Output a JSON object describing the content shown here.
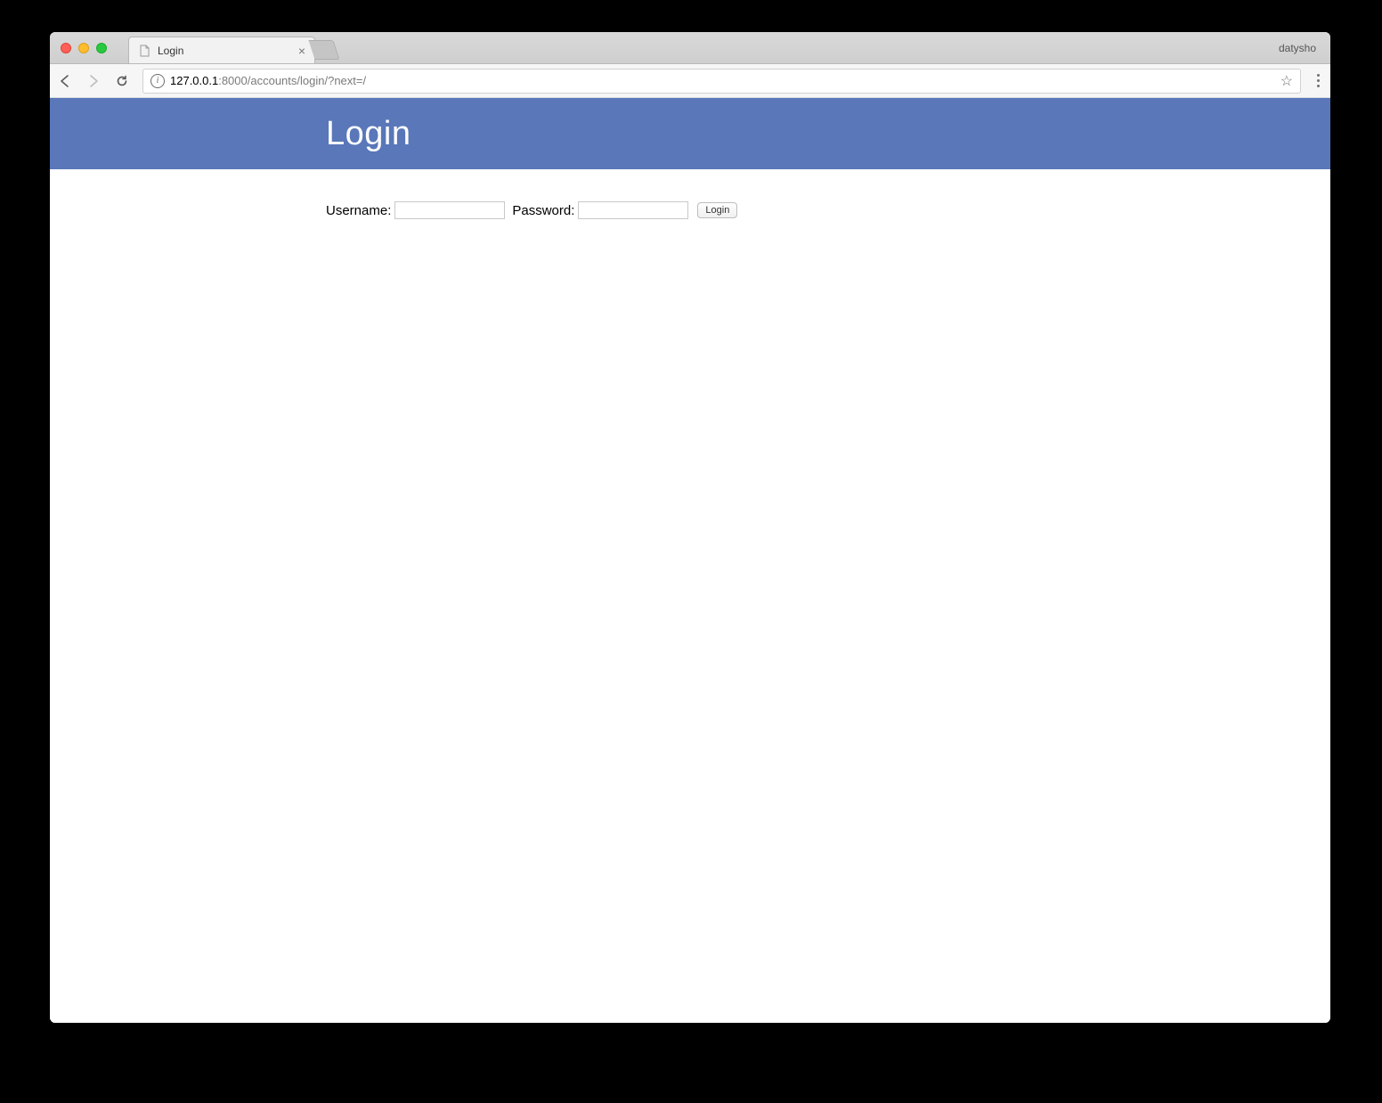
{
  "browser": {
    "profile_name": "datysho",
    "tab": {
      "title": "Login"
    },
    "address": {
      "host": "127.0.0.1",
      "rest": ":8000/accounts/login/?next=/"
    }
  },
  "page": {
    "heading": "Login",
    "form": {
      "username_label": "Username:",
      "username_value": "",
      "password_label": "Password:",
      "password_value": "",
      "submit_label": "Login"
    }
  }
}
